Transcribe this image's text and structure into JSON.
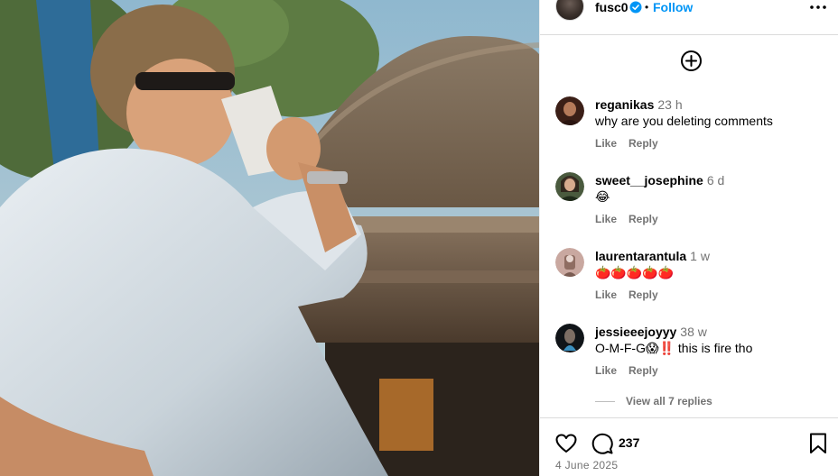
{
  "post": {
    "username": "fusc0",
    "follow_label": "Follow",
    "separator": "•",
    "likes_count": "237",
    "date": "4 June 2025"
  },
  "comments": [
    {
      "username": "reganikas",
      "time": "23 h",
      "text": "why are you deleting comments",
      "like": "Like",
      "reply": "Reply",
      "avatar_color": "#3b1f17"
    },
    {
      "username": "sweet__josephine",
      "time": "6 d",
      "text": "😂",
      "like": "Like",
      "reply": "Reply",
      "avatar_color": "#2f3a2b"
    },
    {
      "username": "laurentarantula",
      "time": "1 w",
      "text": "🍅🍅🍅🍅🍅",
      "like": "Like",
      "reply": "Reply",
      "avatar_color": "#c9a8a0"
    },
    {
      "username": "jessieeejoyyy",
      "time": "38 w",
      "text": "O-M-F-G😱‼️ this is fire tho",
      "like": "Like",
      "reply": "Reply",
      "avatar_color": "#101418"
    }
  ],
  "view_replies_label": "View all 7 replies",
  "colors": {
    "accent": "#0095f6",
    "secondary_text": "#737373",
    "divider": "#dbdbdb"
  },
  "icons": [
    "verified-badge-icon",
    "more-options-icon",
    "add-comment-icon",
    "heart-icon",
    "comment-icon",
    "bookmark-icon"
  ]
}
